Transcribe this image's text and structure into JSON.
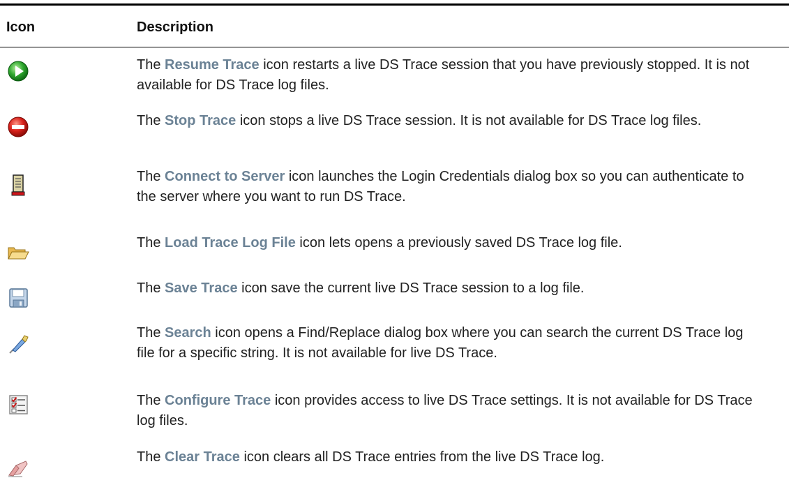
{
  "table": {
    "headers": {
      "icon": "Icon",
      "description": "Description"
    },
    "rows": [
      {
        "icon": "resume-trace-icon",
        "prefix": "The ",
        "term": "Resume Trace",
        "text": " icon restarts a live DS Trace session that you have previously stopped. It is not available for DS Trace log files."
      },
      {
        "icon": "stop-trace-icon",
        "prefix": "The ",
        "term": "Stop Trace",
        "text": " icon stops a live DS Trace session. It is not available for DS Trace log files."
      },
      {
        "icon": "connect-to-server-icon",
        "prefix": "The ",
        "term": "Connect to Server",
        "text": " icon launches the Login Credentials dialog box so you can authenticate to the server where you want to run DS Trace."
      },
      {
        "icon": "load-trace-log-file-icon",
        "prefix": "The ",
        "term": "Load Trace Log File",
        "text": " icon lets opens a previously saved DS Trace log file."
      },
      {
        "icon": "save-trace-icon",
        "prefix": "The ",
        "term": "Save Trace",
        "text": " icon save the current live DS Trace session to a log file."
      },
      {
        "icon": "search-icon",
        "prefix": "The ",
        "term": "Search",
        "text": " icon opens a Find/Replace dialog box where you can search the current DS Trace log file for a specific string. It is not available for live DS Trace."
      },
      {
        "icon": "configure-trace-icon",
        "prefix": "The ",
        "term": "Configure Trace",
        "text": " icon provides access to live DS Trace settings. It is not available for DS Trace log files."
      },
      {
        "icon": "clear-trace-icon",
        "prefix": "The ",
        "term": "Clear Trace",
        "text": " icon clears all DS Trace entries from the live DS Trace log."
      }
    ]
  },
  "colors": {
    "term": "#6b8295",
    "text": "#222222",
    "rule": "#000000"
  }
}
